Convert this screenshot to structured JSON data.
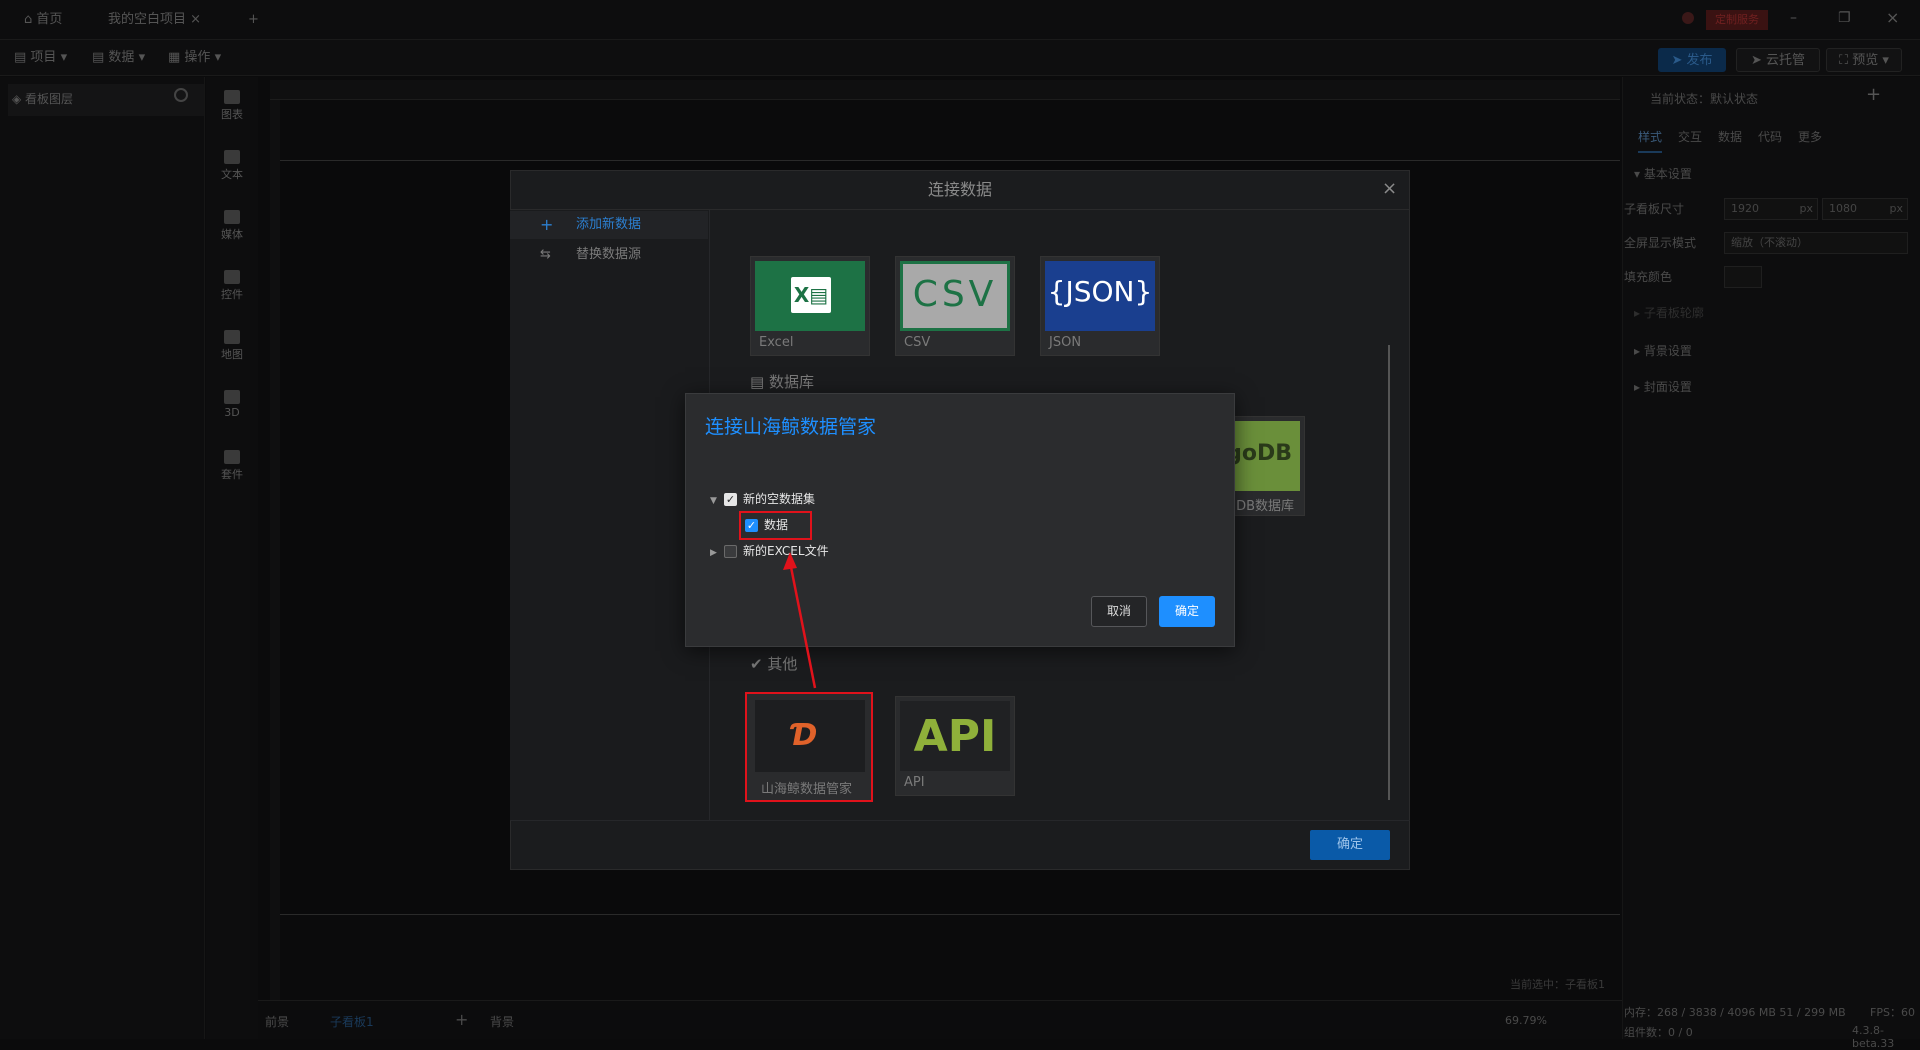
{
  "topbar": {
    "home_label": "首页",
    "project_tab": "我的空白项目",
    "custom_service": "定制服务"
  },
  "menubar": {
    "project": "项目",
    "data": "数据",
    "operate": "操作",
    "publish": "发布",
    "cloud": "云托管",
    "preview": "预览"
  },
  "layers": {
    "title": "看板图层"
  },
  "tools": [
    {
      "label": "图表"
    },
    {
      "label": "文本"
    },
    {
      "label": "媒体"
    },
    {
      "label": "控件"
    },
    {
      "label": "地图"
    },
    {
      "label": "3D"
    },
    {
      "label": "套件"
    }
  ],
  "rightpanel": {
    "state": "当前状态：默认状态",
    "tabs": [
      "样式",
      "交互",
      "数据",
      "代码",
      "更多"
    ],
    "basic": "基本设置",
    "size_label": "子看板尺寸",
    "width": "1920",
    "height": "1080",
    "unit": "px",
    "fullscreen_label": "全屏显示模式",
    "fullscreen_value": "缩放（不滚动）",
    "fill_label": "填充颜色",
    "outline": "子看板轮廓",
    "background": "背景设置",
    "cover": "封面设置"
  },
  "bottombar": {
    "front": "前景",
    "subboard": "子看板1",
    "back": "背景",
    "zoom": "69.79%",
    "current_selected": "当前选中：子看板1",
    "memory": "内存：268 / 3838 / 4096 MB  51 / 299 MB",
    "fps": "FPS：60",
    "components": "组件数：0 / 0",
    "version": "4.3.8-beta.33"
  },
  "modal": {
    "title": "连接数据",
    "add_new": "添加新数据",
    "replace": "替换数据源",
    "cards_file": [
      {
        "label": "Excel"
      },
      {
        "label": "CSV",
        "art": "CSV"
      },
      {
        "label": "JSON",
        "art": "{JSON}"
      }
    ],
    "db_section": "数据库",
    "mongo_label": "DB数据库",
    "mongo_art": "goDB",
    "other_section": "其他",
    "cards_other": [
      {
        "label": "山海鲸数据管家"
      },
      {
        "label": "API",
        "art": "API"
      }
    ],
    "ok": "确定"
  },
  "dialog": {
    "title": "连接山海鲸数据管家",
    "tree": [
      {
        "label": "新的空数据集"
      },
      {
        "label": "数据"
      },
      {
        "label": "新的EXCEL文件"
      }
    ],
    "cancel": "取消",
    "ok": "确定"
  },
  "colors": {
    "accent": "#1e8fff",
    "highlight": "#e0121b"
  }
}
